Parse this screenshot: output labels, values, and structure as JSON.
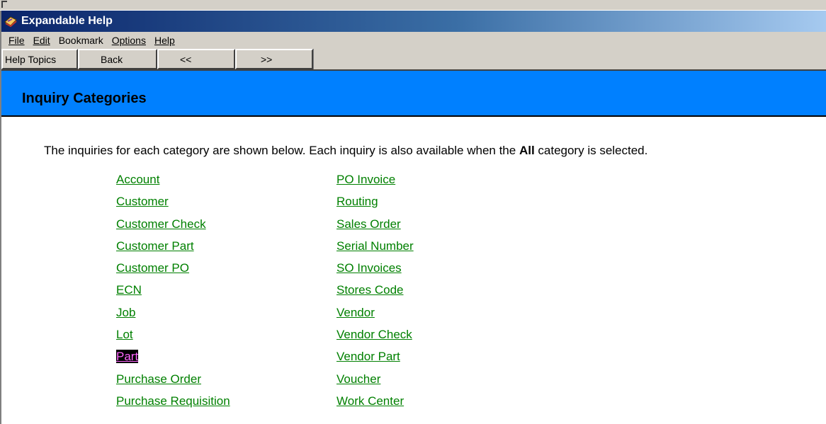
{
  "window": {
    "title": "Expandable Help"
  },
  "menu": {
    "items": [
      {
        "label": "File"
      },
      {
        "label": "Edit"
      },
      {
        "label": "Bookmark"
      },
      {
        "label": "Options"
      },
      {
        "label": "Help"
      }
    ]
  },
  "toolbar": {
    "help_topics_label": "Help Topics",
    "back_label": "Back",
    "prev_label": "<<",
    "next_label": ">>"
  },
  "page": {
    "title": "Inquiry Categories",
    "intro_before": "The inquiries for each category are shown below. Each inquiry is also available when the ",
    "intro_bold": "All",
    "intro_after": " category is selected."
  },
  "links": {
    "left": [
      "Account",
      "Customer",
      "Customer Check",
      "Customer Part",
      "Customer PO",
      "ECN",
      "Job",
      "Lot",
      "Part",
      "Purchase Order",
      "Purchase Requisition"
    ],
    "right": [
      "PO Invoice",
      "Routing",
      "Sales Order",
      "Serial Number",
      "SO Invoices",
      "Stores Code",
      "Vendor",
      "Vendor Check",
      "Vendor Part",
      "Voucher",
      "Work Center"
    ],
    "selected": "Part"
  },
  "colors": {
    "header_bg": "#0080ff",
    "link": "#008000",
    "title_bar": "#0a246a",
    "selected_bg": "#000000",
    "selected_text": "#ff66ff"
  }
}
